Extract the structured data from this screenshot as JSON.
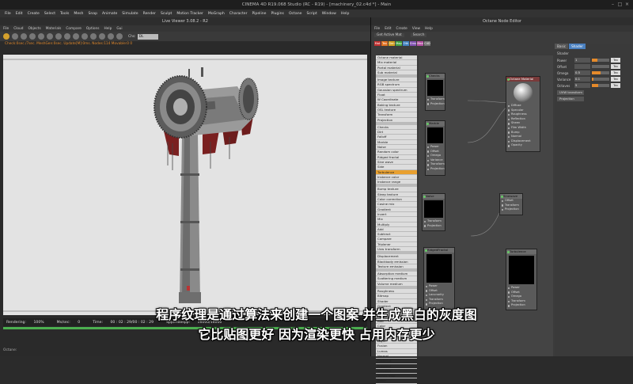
{
  "app": {
    "window_title": "CINEMA 4D R19.068 Studio (RC - R19) - [machinery_02.c4d *] - Main",
    "menus": [
      "File",
      "Edit",
      "Create",
      "Select",
      "Tools",
      "Mesh",
      "Snap",
      "Animate",
      "Simulate",
      "Render",
      "Sculpt",
      "Motion Tracker",
      "MoGraph",
      "Character",
      "Pipeline",
      "Plugins",
      "Octane",
      "Script",
      "Window",
      "Help"
    ],
    "layout_label": "Layout:",
    "layout_value": "Startup"
  },
  "live_viewer": {
    "title": "Live Viewer 3.08.2 - R2",
    "menus": [
      "File",
      "Cloud",
      "Objects",
      "Materials",
      "Compare",
      "Options",
      "Help",
      "Gui"
    ],
    "channel_label": "Chs:",
    "channel_value": "DL",
    "info_line": "Check:0sec./7sec.  MeshGen:0sec.  Update[M]:0ms.  Nodes:114  Movable:0  0",
    "status": {
      "rendering_label": "Rendering:",
      "rendering_pct": "100%",
      "ms_sec_label": "Ms/sec:",
      "ms_sec": "0",
      "time_label": "Time:",
      "time": "00 : 02 : 29/00 : 02 : 29",
      "spp_label": "Spp/maxspp:",
      "spp": "16000/16000"
    },
    "progress": 1.0,
    "bottom_label": "Octane:"
  },
  "node_editor": {
    "title": "Octane Node Editor",
    "menus": [
      "File",
      "Edit",
      "Create",
      "View",
      "Help"
    ],
    "toolbar": {
      "get_active": "Get Active Mat",
      "search": "Search"
    },
    "tabs": [
      {
        "label": "Mat",
        "color": "#c03030"
      },
      {
        "label": "Tex",
        "color": "#e07020"
      },
      {
        "label": "Gen",
        "color": "#d0a020"
      },
      {
        "label": "Map",
        "color": "#40a040"
      },
      {
        "label": "Oth",
        "color": "#4080c0"
      },
      {
        "label": "Ems",
        "color": "#8050b0"
      },
      {
        "label": "Med",
        "color": "#b050a0"
      },
      {
        "label": "C4D",
        "color": "#707070"
      }
    ],
    "node_list": [
      "Octane material",
      "Mix material",
      "Portal material",
      "Sub material",
      "",
      "Image texture",
      "RGB spectrum",
      "Gaussian spectrum",
      "Float",
      "W Coordinate",
      "Baking texture",
      "OSL texture",
      "Transform",
      "Projection",
      "",
      "Checks",
      "Dirt",
      "Falloff",
      "Marble",
      "Noise",
      "Random color",
      "Ridged fractal",
      "Sine wave",
      "Side",
      "Turbulence",
      "Instance color",
      "Instance range",
      "",
      "Bump texture",
      "Sleep texture",
      "Color correction",
      "Cosine mix",
      "Gradient",
      "Invert",
      "Mix",
      "Multiply",
      "Add",
      "Subtract",
      "Compare",
      "Triplanar",
      "Uvw transform",
      "",
      "Displacement",
      "Blackbody emission",
      "Texture emission",
      "",
      "Absorption medium",
      "Scattering medium",
      "Volume medium",
      "",
      "Roughness",
      "Bitmap",
      "Shader",
      "Gradient",
      "Noise",
      "Fresnel",
      "Add",
      "Color",
      "Tile",
      "Filter",
      "Layer",
      "Fusion",
      "Lumas",
      "Normal",
      "Posterize",
      "Proximal",
      "Variation",
      "Vertex map",
      "Baker"
    ],
    "highlight_item": "Turbulence",
    "nodes": {
      "checks": {
        "title": "Checks",
        "ports": [
          "Transform",
          "Projection"
        ]
      },
      "marble": {
        "title": "Marble",
        "ports": [
          "Power",
          "Offset",
          "Omega",
          "Variance",
          "Transform",
          "Projection"
        ]
      },
      "octane_material": {
        "title": "Octane Material",
        "ports": [
          "Diffuse",
          "Specular",
          "Roughness",
          "Reflection",
          "Sheen",
          "Film Width",
          "Bump",
          "Normal",
          "Displacement",
          "Opacity"
        ]
      },
      "noise": {
        "title": "Noise",
        "ports": [
          "Transform",
          "Projection"
        ]
      },
      "sine_wave": {
        "title": "Sinewave",
        "ports": [
          "Offset",
          "Transform",
          "Projection"
        ]
      },
      "ridged_fractal": {
        "title": "RidgedFractal",
        "ports": [
          "Power",
          "Offset",
          "Lacunarity",
          "Transform",
          "Projection"
        ]
      },
      "turbulence": {
        "title": "Turbulence",
        "ports": [
          "Power",
          "Offset",
          "Omega",
          "Transform",
          "Projection"
        ]
      }
    },
    "properties": {
      "tabs": [
        "Basic",
        "Shader"
      ],
      "shader_label": "Shader",
      "rows": [
        {
          "label": "Power",
          "value": "1",
          "fill": 0.3,
          "mode": "Tex"
        },
        {
          "label": "Offset",
          "value": "",
          "fill": 0.0,
          "mode": "Tex"
        },
        {
          "label": "Omega",
          "value": "0.5",
          "fill": 0.5,
          "mode": "Tex"
        },
        {
          "label": "Variance",
          "value": "0.1",
          "fill": 0.1,
          "mode": "Tex"
        },
        {
          "label": "Octaves",
          "value": "5",
          "fill": 0.35,
          "mode": "Tex"
        }
      ],
      "buttons": [
        "UVW transform",
        "Projection"
      ]
    }
  },
  "subtitles": {
    "line1": "程序纹理是通过算法来创建一个图案 并生成黑白的灰度图",
    "line2": "它比贴图更好 因为渲染更快 占用内存更少"
  }
}
